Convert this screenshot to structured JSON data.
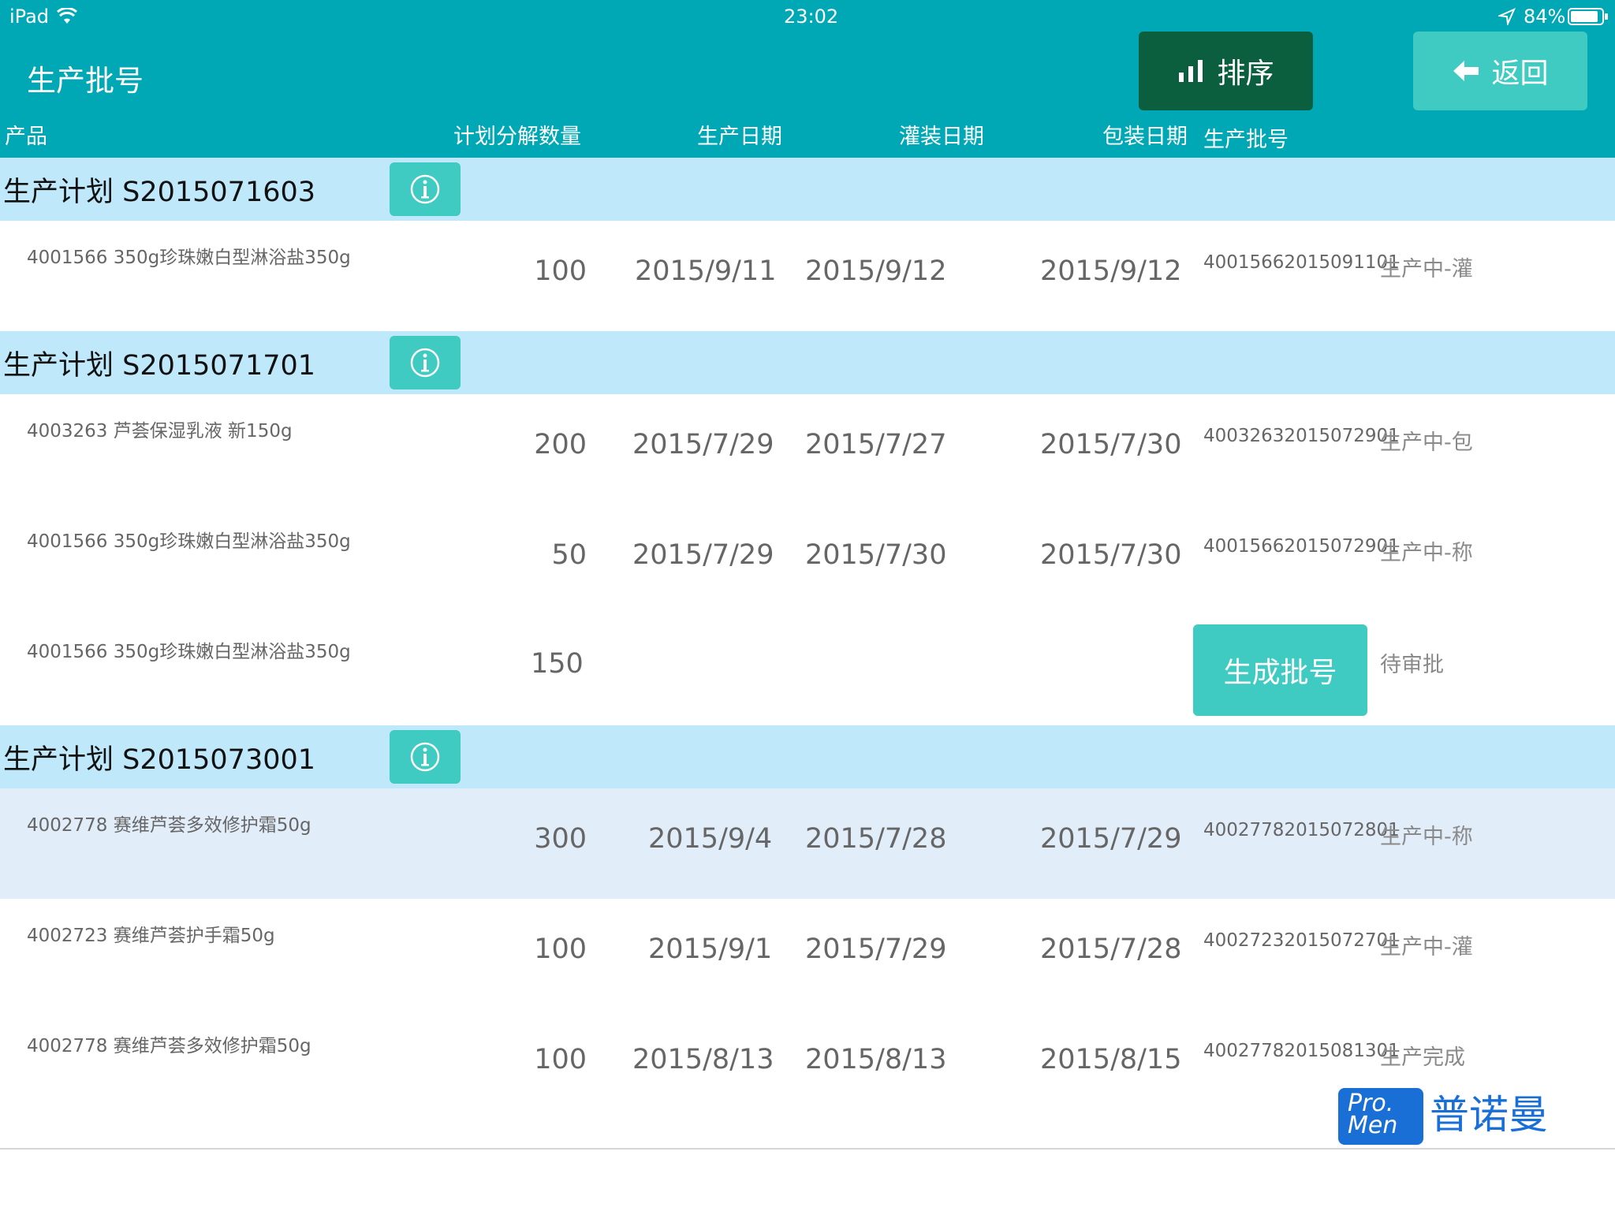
{
  "status_bar": {
    "device": "iPad",
    "time": "23:02",
    "battery": "84%"
  },
  "header": {
    "title": "生产批号",
    "sort_label": "排序",
    "back_label": "返回"
  },
  "columns": {
    "product": "产品",
    "planned_qty": "计划分解数量",
    "production_date": "生产日期",
    "filling_date": "灌装日期",
    "packaging_date": "包装日期",
    "batch_number": "生产批号"
  },
  "groups": [
    {
      "title": "生产计划 S2015071603"
    },
    {
      "title": "生产计划 S2015071701"
    },
    {
      "title": "生产计划 S2015073001"
    }
  ],
  "rows": [
    {
      "product": "4001566  350g珍珠嫩白型淋浴盐350g",
      "qty": "100",
      "production": "2015/9/11",
      "filling": "2015/9/12",
      "packaging": "2015/9/12",
      "batch": "40015662015091101",
      "status": "生产中-灌"
    },
    {
      "product": "4003263  芦荟保湿乳液  新150g",
      "qty": "200",
      "production": "2015/7/29",
      "filling": "2015/7/27",
      "packaging": "2015/7/30",
      "batch": "40032632015072901",
      "status": "生产中-包"
    },
    {
      "product": "4001566  350g珍珠嫩白型淋浴盐350g",
      "qty": "50",
      "production": "2015/7/29",
      "filling": "2015/7/30",
      "packaging": "2015/7/30",
      "batch": "40015662015072901",
      "status": "生产中-称"
    },
    {
      "product": "4001566  350g珍珠嫩白型淋浴盐350g",
      "qty": "150",
      "button": "生成批号",
      "status": "待审批"
    },
    {
      "product": "4002778  赛维芦荟多效修护霜50g",
      "qty": "300",
      "production": "2015/9/4",
      "filling": "2015/7/28",
      "packaging": "2015/7/29",
      "batch": "40027782015072801",
      "status": "生产中-称"
    },
    {
      "product": "4002723  赛维芦荟护手霜50g",
      "qty": "100",
      "production": "2015/9/1",
      "filling": "2015/7/29",
      "packaging": "2015/7/28",
      "batch": "40027232015072701",
      "status": "生产中-灌"
    },
    {
      "product": "4002778  赛维芦荟多效修护霜50g",
      "qty": "100",
      "production": "2015/8/13",
      "filling": "2015/8/13",
      "packaging": "2015/8/15",
      "batch": "40027782015081301",
      "status": "生产完成"
    }
  ],
  "logo": {
    "badge_line1": "Pro.",
    "badge_line2": "Men",
    "text": "普诺曼"
  },
  "colors": {
    "header": "#00a8b6",
    "group_bar": "#bfe9fa",
    "accent": "#3fcbc1",
    "sort_button": "#0b5e3e",
    "selected_row": "#e1edf9"
  }
}
